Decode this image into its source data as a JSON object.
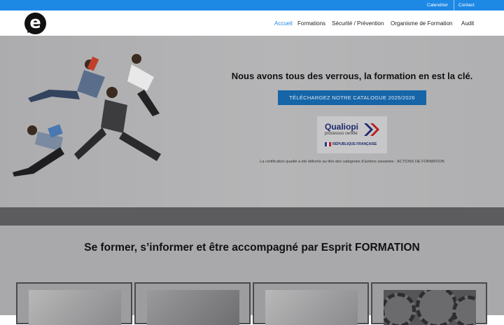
{
  "topbar": {
    "calendar_label": "Calendrier",
    "contact_label": "Contact"
  },
  "header": {
    "logo_letter": "e",
    "nav": [
      {
        "label": "Accueil"
      },
      {
        "label": "Formations"
      },
      {
        "label": "Sécurité / Prévention"
      },
      {
        "label": "Organisme de Formation"
      },
      {
        "label": "Audit"
      }
    ]
  },
  "hero": {
    "tagline": "Nous avons tous des verrous, la formation en est la clé.",
    "cta_label": "TÉLÉCHARGEZ NOTRE CATALOGUE 2025/2026",
    "qualiopi": {
      "title": "Qualiopi",
      "subtitle": "processus certifié",
      "republic": "RÉPUBLIQUE FRANÇAISE"
    },
    "certification_text": "La certification qualité a été délivrée au titre des catégories d’actions suivantes : ACTIONS DE FORMATION"
  },
  "section": {
    "title": "Se former, s’informer et être accompagné par Esprit FORMATION",
    "cards": [
      {
        "image": "training-room-photo"
      },
      {
        "image": "workers-photo"
      },
      {
        "image": "training-room-photo"
      },
      {
        "image": "gears-photo"
      }
    ]
  },
  "colors": {
    "accent": "#1e88e5",
    "cta": "#1565a8",
    "overlay": "#a9a9ab"
  }
}
